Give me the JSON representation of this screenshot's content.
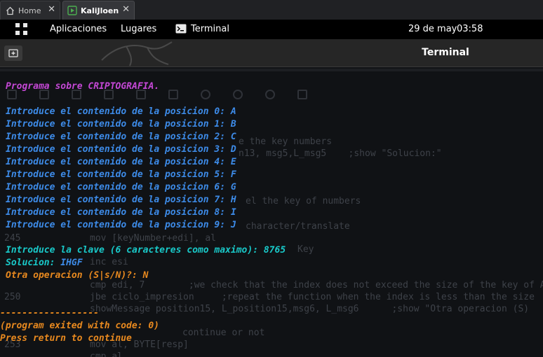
{
  "browser_tabs": [
    {
      "label": "Home",
      "icon": "home-icon"
    },
    {
      "label": "KaliJloen",
      "icon": "vm-play-icon",
      "active": true
    }
  ],
  "panel": {
    "applications": "Aplicaciones",
    "places": "Lugares",
    "terminal": "Terminal",
    "date": "29 de may",
    "time": "03:58"
  },
  "terminal_window": {
    "title": "Terminal"
  },
  "terminal_output": {
    "header": "Programa sobre CRIPTOGRAFIA.",
    "positions": [
      "Introduce el contenido de la posicion 0: A",
      "Introduce el contenido de la posicion 1: B",
      "Introduce el contenido de la posicion 2: C",
      "Introduce el contenido de la posicion 3: D",
      "Introduce el contenido de la posicion 4: E",
      "Introduce el contenido de la posicion 5: F",
      "Introduce el contenido de la posicion 6: G",
      "Introduce el contenido de la posicion 7: H",
      "Introduce el contenido de la posicion 8: I",
      "Introduce el contenido de la posicion 9: J"
    ],
    "key_prompt": "Introduce la clave (6 caracteres como maximo): 8765",
    "solution_label": "Solucion: ",
    "solution_value": "IHGF",
    "again_prompt": "Otra operacion (S|s/N)?: N",
    "separator": "------------------",
    "exit_msg": "(program exited with code: 0)",
    "return_msg": "Press return to continue"
  },
  "background_code": [
    "e the key numbers",
    "n13, msg5,L_msg5    ;show \"Solucion:\"",
    "el the key of numbers",
    "character/translate",
    "mov [keyNumber+edi], al",
    "Key",
    "inc esi",
    "cmp edi, 7        ;we check that the index does not exceed the size of the key of A",
    "jbe ciclo_impresion     ;repeat the function when the index is less than the size",
    "showMessage position15, L_position15,msg6, L_msg6      ;show \"Otra operacion (S)",
    "continue or not",
    "mov al, BYTE[resp]",
    "cmp al"
  ],
  "line_numbers": [
    "245",
    "250",
    "253"
  ]
}
